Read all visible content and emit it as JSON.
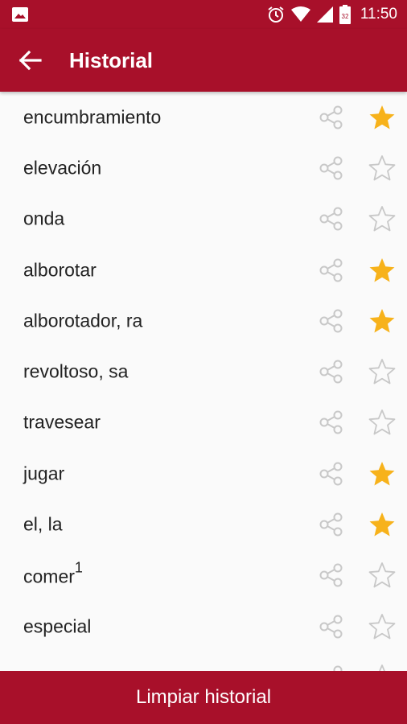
{
  "status_bar": {
    "time": "11:50",
    "icons": [
      "image-icon",
      "alarm-icon",
      "wifi-icon",
      "signal-icon",
      "battery-icon"
    ],
    "battery_level_label": "32"
  },
  "app_bar": {
    "title": "Historial",
    "back_icon": "arrow-back-icon"
  },
  "colors": {
    "primary": "#a8102a",
    "star_active": "#f7b21b",
    "icon_inactive": "#c8c8c8"
  },
  "history": {
    "items": [
      {
        "word": "encumbramiento",
        "sup": "",
        "favorite": true
      },
      {
        "word": "elevación",
        "sup": "",
        "favorite": false
      },
      {
        "word": "onda",
        "sup": "",
        "favorite": false
      },
      {
        "word": "alborotar",
        "sup": "",
        "favorite": true
      },
      {
        "word": "alborotador, ra",
        "sup": "",
        "favorite": true
      },
      {
        "word": "revoltoso, sa",
        "sup": "",
        "favorite": false
      },
      {
        "word": "travesear",
        "sup": "",
        "favorite": false
      },
      {
        "word": "jugar",
        "sup": "",
        "favorite": true
      },
      {
        "word": "el, la",
        "sup": "",
        "favorite": true
      },
      {
        "word": "comer",
        "sup": "1",
        "favorite": false
      },
      {
        "word": "especial",
        "sup": "",
        "favorite": false
      },
      {
        "word": "",
        "sup": "",
        "favorite": false
      }
    ]
  },
  "footer": {
    "clear_label": "Limpiar historial"
  }
}
